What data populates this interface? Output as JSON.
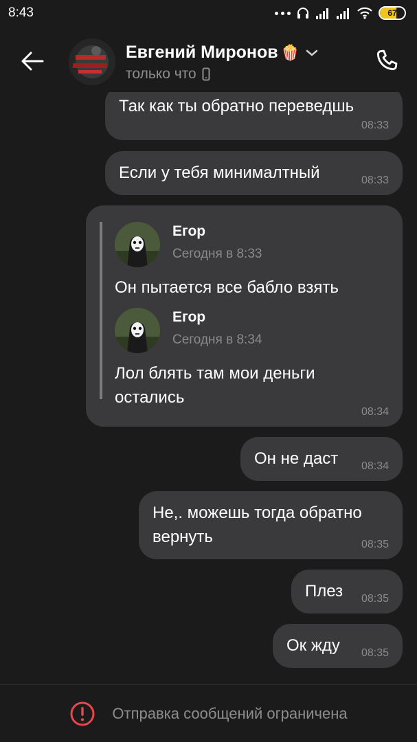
{
  "status_bar": {
    "time": "8:43",
    "battery": "67",
    "battery_level": 0.67,
    "icons": [
      "more-dots-icon",
      "headphones-icon",
      "signal-icon",
      "signal-icon",
      "wifi-icon",
      "battery-icon"
    ]
  },
  "header": {
    "name": "Евгений Миронов",
    "name_emoji": "🍿",
    "status": "только что",
    "icons": [
      "back-arrow-icon",
      "chevron-down-icon",
      "mobile-icon",
      "phone-icon"
    ]
  },
  "messages": [
    {
      "text": "Так как ты обратно переведшь",
      "time": "08:33"
    },
    {
      "text": "Если у тебя минималтный",
      "time": "08:33"
    },
    {
      "forwarded": [
        {
          "author": "Егор",
          "date": "Сегодня в 8:33",
          "text": "Он пытается все бабло взять"
        },
        {
          "author": "Егор",
          "date": "Сегодня в 8:34",
          "text": "Лол блять там мои деньги остались"
        }
      ],
      "time": "08:34"
    },
    {
      "text": "Он не даст",
      "time": "08:34"
    },
    {
      "text": "Не,. можешь тогда обратно вернуть",
      "time": "08:35"
    },
    {
      "text": "Плез",
      "time": "08:35"
    },
    {
      "text": "Ок жду",
      "time": "08:35"
    }
  ],
  "footer": {
    "text": "Отправка сообщений ограничена",
    "icon": "alert-circle-icon",
    "alert_color": "#e5484d"
  },
  "colors": {
    "background": "#1b1b1b",
    "bubble": "#3a3a3c",
    "secondary_text": "#8d8d8d"
  }
}
